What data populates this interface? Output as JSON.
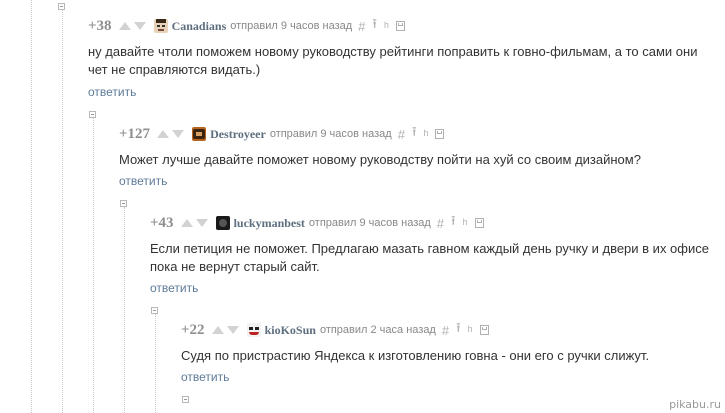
{
  "comments": [
    {
      "rating": "+38",
      "username": "Canadians",
      "meta": "отправил 9 часов назад",
      "text": "ну давайте чтоли поможем новому руководству рейтинги поправить к говно-фильмам, а то сами они чет не справляются видать.)",
      "reply_label": "ответить",
      "avatar_icon": "user-face-icon"
    },
    {
      "rating": "+127",
      "username": "Destroyeer",
      "meta": "отправил 9 часов назад",
      "text": "Может лучше давайте поможет новому руководству пойти на хуй со своим дизайном?",
      "reply_label": "ответить",
      "avatar_icon": "user-avatar-icon"
    },
    {
      "rating": "+43",
      "username": "luckymanbest",
      "meta": "отправил 9 часов назад",
      "text": "Если петиция не поможет. Предлагаю мазать гавном каждый день ручку и двери в их офисе пока не вернут старый сайт.",
      "reply_label": "ответить",
      "avatar_icon": "user-avatar-icon"
    },
    {
      "rating": "+22",
      "username": "kioKoSun",
      "meta": "отправил 2 часа назад",
      "text": "Судя по пристрастию Яндекса к изготовлению говна - они его с ручки слижут.",
      "reply_label": "ответить",
      "avatar_icon": "joker-face-icon"
    }
  ],
  "tool_icons": {
    "hash": "#",
    "up_to_parent": "⭱",
    "branch": "ʰ"
  },
  "colors": {
    "username": "#5d6e7f",
    "reply_link": "#5d7a99",
    "rating": "#8f8f8f",
    "arrows": "#d2d2d2"
  },
  "watermark": "pikabu.ru"
}
